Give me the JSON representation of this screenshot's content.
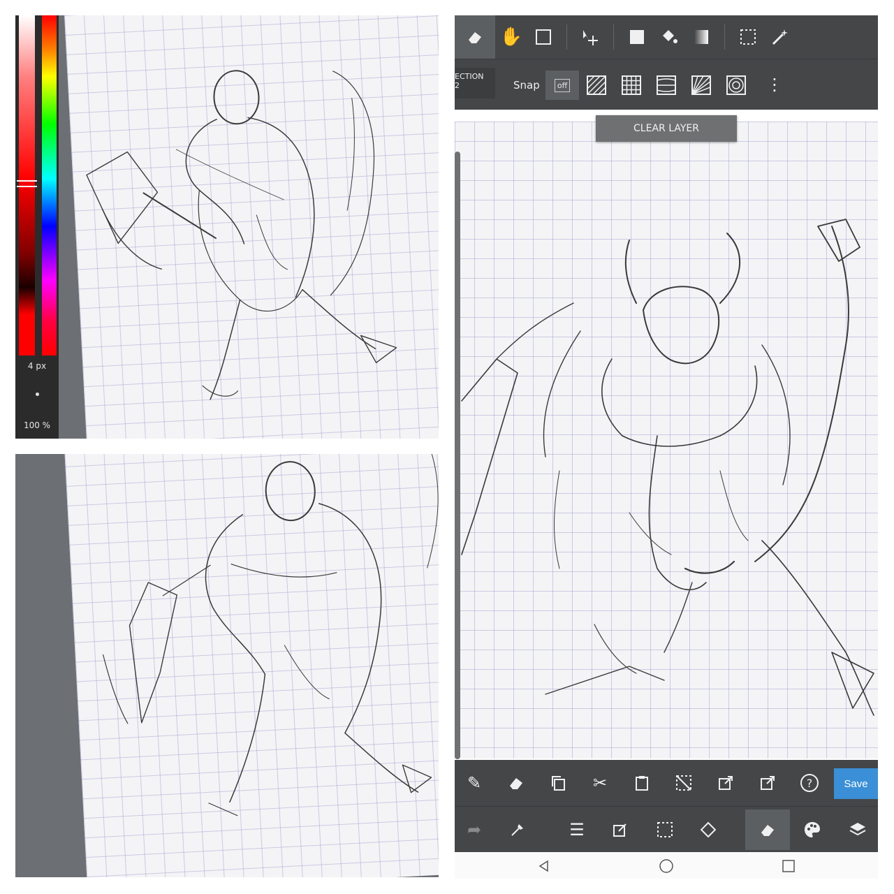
{
  "color_panel": {
    "brush_size": "4 px",
    "opacity": "100 %"
  },
  "toolbar_top": {
    "tools": [
      "eraser-icon",
      "hand-icon",
      "rectangle-icon",
      "move-icon",
      "fill-square-icon",
      "bucket-icon",
      "gradient-icon",
      "selection-icon",
      "magic-wand-icon"
    ],
    "active": "eraser-icon"
  },
  "snap_bar": {
    "section_label": "ECTION\n2",
    "snap_label": "Snap",
    "snap_off_label": "off",
    "snap_modes": [
      "parallel-lines-icon",
      "grid-icon",
      "vanishing-lines-icon",
      "perspective-icon",
      "concentric-icon"
    ],
    "more_icon": "more-vertical-icon"
  },
  "canvas": {
    "clear_layer_label": "CLEAR LAYER"
  },
  "bottom_bar_1": {
    "tools": [
      "pencil-icon",
      "eraser-icon",
      "copy-icon",
      "cut-icon",
      "paste-icon",
      "deselect-icon",
      "export-icon",
      "share-icon",
      "help-icon"
    ],
    "save_label": "Save"
  },
  "bottom_bar_2": {
    "tools": [
      "redo-icon",
      "eyedropper-icon",
      "menu-icon",
      "edit-icon",
      "selection-icon",
      "rotate-icon",
      "eraser-icon",
      "palette-icon",
      "layers-icon"
    ],
    "active": "eraser-icon"
  },
  "navbar": {
    "buttons": [
      "back-icon",
      "home-icon",
      "recents-icon"
    ]
  },
  "colors": {
    "toolbar_bg": "#444648",
    "active_bg": "#5c5f61",
    "save_bg": "#3a8fd6",
    "paper": "#f4f4f6",
    "workspace": "#6c6f73"
  }
}
